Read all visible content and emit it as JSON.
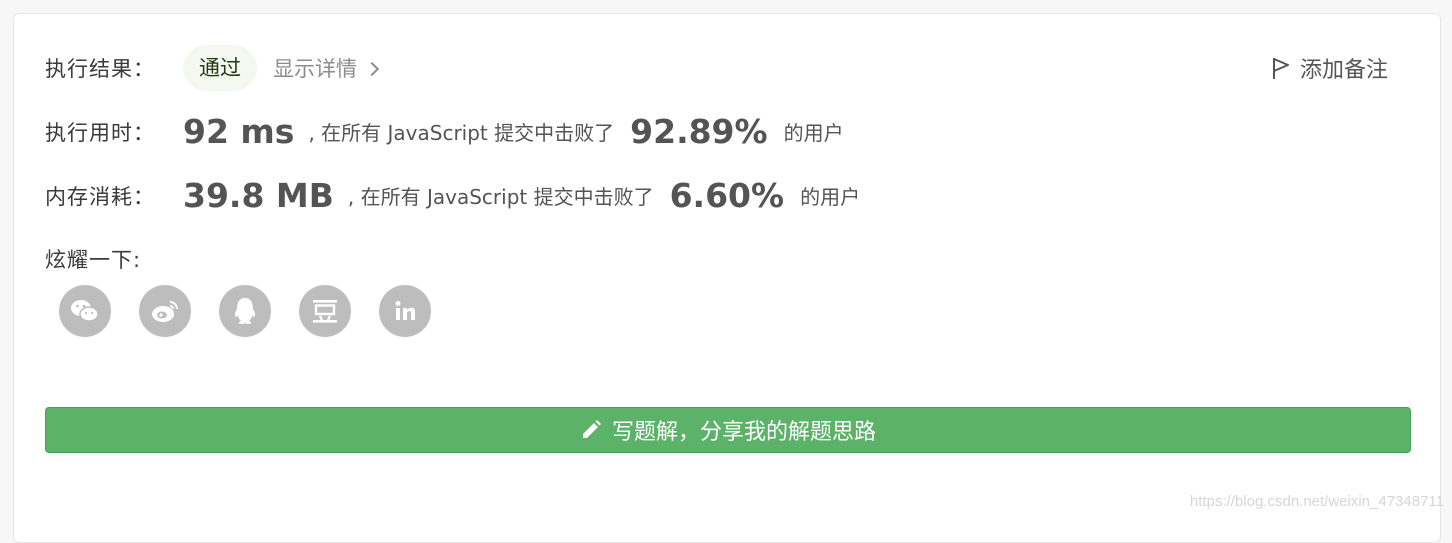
{
  "result": {
    "label": "执行结果：",
    "status": "通过",
    "details_link": "显示详情",
    "add_note": "添加备注"
  },
  "runtime": {
    "label": "执行用时：",
    "value": "92 ms",
    "text": ", 在所有 JavaScript 提交中击败了",
    "percent": "92.89%",
    "suffix": "的用户"
  },
  "memory": {
    "label": "内存消耗：",
    "value": "39.8 MB",
    "text": ", 在所有 JavaScript 提交中击败了",
    "percent": "6.60%",
    "suffix": "的用户"
  },
  "share": {
    "label": "炫耀一下:",
    "icons": [
      "wechat-icon",
      "weibo-icon",
      "qq-icon",
      "douban-icon",
      "linkedin-icon"
    ]
  },
  "write_solution": {
    "label": "写题解，分享我的解题思路"
  },
  "watermark": "https://blog.csdn.net/weixin_47348711",
  "colors": {
    "accent_green": "#5cb269",
    "pass_badge_bg": "#f4f8f1",
    "share_icon_bg": "#bdbdbd"
  }
}
